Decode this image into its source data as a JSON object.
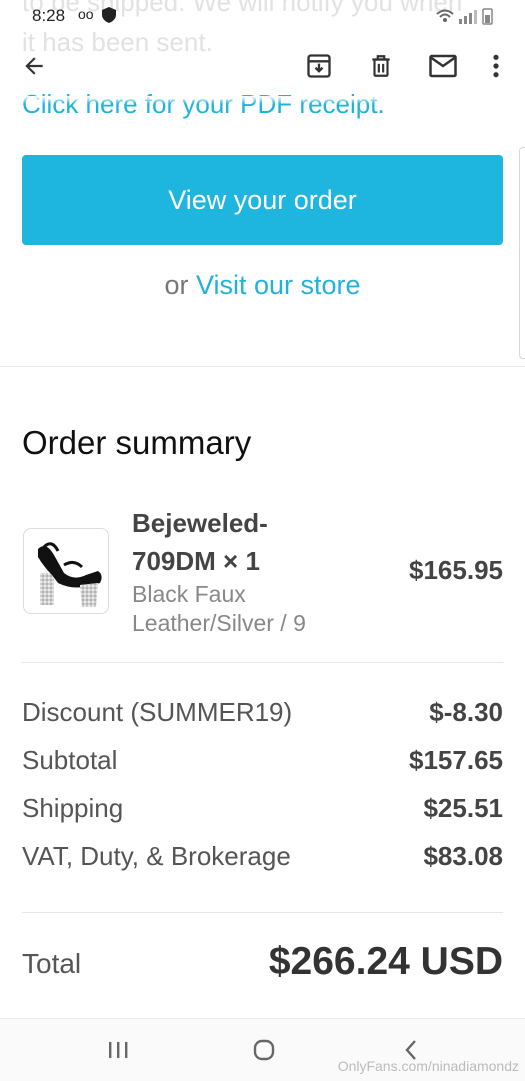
{
  "faded_background": {
    "line1": "to be shipped. We will notify you when",
    "line2": "it has been sent."
  },
  "status_bar": {
    "time": "8:28",
    "voicemail": "oo"
  },
  "app_bar": {
    "icons": [
      "back-arrow-icon",
      "archive-icon",
      "delete-icon",
      "mail-icon",
      "more-vert-icon"
    ]
  },
  "email": {
    "receipt_link": "Click here for your PDF receipt.",
    "view_order_button": "View your order",
    "store_prefix": "or",
    "store_link": "Visit our store"
  },
  "order_summary": {
    "title": "Order summary",
    "item": {
      "name": "Bejeweled-709DM × 1",
      "variant": "Black Faux Leather/Silver / 9",
      "price": "$165.95"
    },
    "lines": [
      {
        "label": "Discount (SUMMER19)",
        "value": "$-8.30"
      },
      {
        "label": "Subtotal",
        "value": "$157.65"
      },
      {
        "label": "Shipping",
        "value": "$25.51"
      },
      {
        "label": "VAT, Duty, & Brokerage",
        "value": "$83.08"
      }
    ],
    "total_label": "Total",
    "total_value": "$266.24 USD"
  },
  "watermark": "OnlyFans.com/ninadiamondz",
  "colors": {
    "accent": "#1eb6de",
    "link": "#1fb3dc"
  }
}
